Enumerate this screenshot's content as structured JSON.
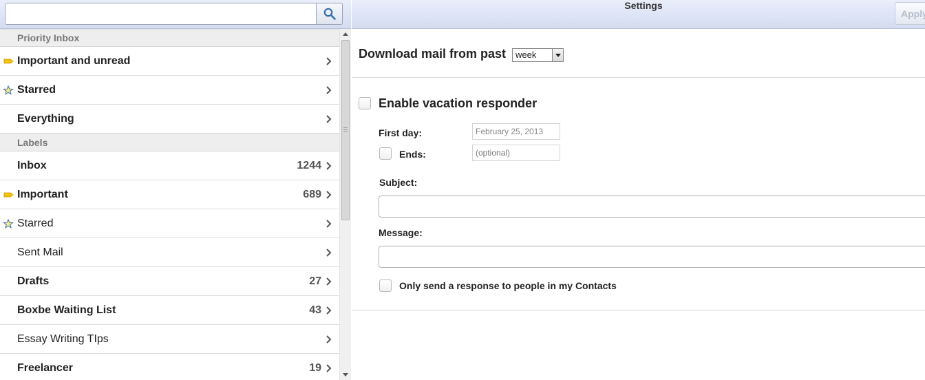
{
  "search": {
    "placeholder": ""
  },
  "nav": {
    "sections": {
      "priority_inbox": "Priority Inbox",
      "labels": "Labels"
    },
    "priority": [
      {
        "label": "Important and unread",
        "icon": "important-tag-icon",
        "count": ""
      },
      {
        "label": "Starred",
        "icon": "star-icon",
        "count": ""
      },
      {
        "label": "Everything",
        "icon": "",
        "count": ""
      }
    ],
    "labels": [
      {
        "label": "Inbox",
        "count": "1244"
      },
      {
        "label": "Important",
        "count": "689"
      },
      {
        "label": "Starred",
        "count": ""
      },
      {
        "label": "Sent Mail",
        "count": ""
      },
      {
        "label": "Drafts",
        "count": "27"
      },
      {
        "label": "Boxbe Waiting List",
        "count": "43"
      },
      {
        "label": "Essay Writing TIps",
        "count": ""
      },
      {
        "label": "Freelancer",
        "count": "19"
      }
    ]
  },
  "header": {
    "title": "Settings",
    "apply_label": "Apply"
  },
  "settings": {
    "download_label": "Download mail from past",
    "download_value": "week",
    "vacation_label": "Enable vacation responder",
    "first_day_label": "First day:",
    "first_day_value": "February 25, 2013",
    "ends_label": "Ends:",
    "ends_placeholder": "(optional)",
    "subject_label": "Subject:",
    "message_label": "Message:",
    "contacts_only_label": "Only send a response to people in my Contacts"
  },
  "colors": {
    "tag_yellow": "#f4c20d",
    "header_blue": "#d9e1f4"
  }
}
